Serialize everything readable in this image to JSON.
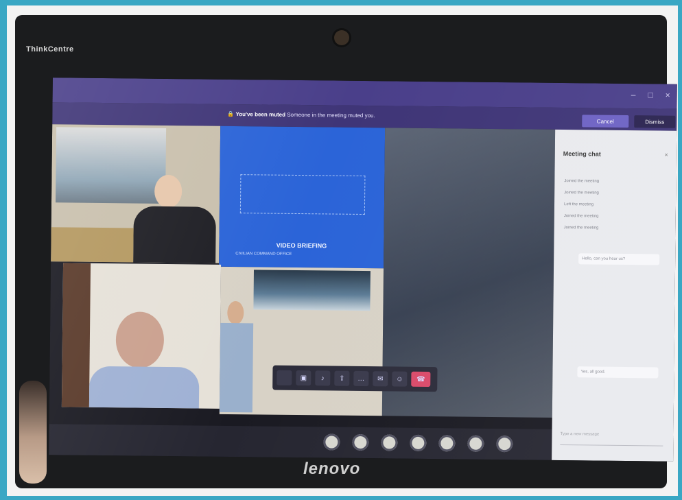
{
  "device": {
    "brand_top": "ThinkCentre",
    "brand_bottom": "lenovo"
  },
  "meeting": {
    "notice_bold": "You've been muted",
    "notice_text": "Someone in the meeting muted you.",
    "cancel_label": "Cancel",
    "dismiss_label": "Dismiss",
    "window_controls": [
      "–",
      "□",
      "×"
    ]
  },
  "presentation": {
    "title": "VIDEO BRIEFING",
    "subtitle": "CIVILIAN COMMAND OFFICE"
  },
  "chat": {
    "title": "Meeting chat",
    "close": "×",
    "lines": [
      "Joined the meeting",
      "Joined the meeting",
      "Left the meeting",
      "Joined the meeting",
      "Joined the meeting"
    ],
    "bubble_1": "Hello, can you hear us?",
    "bubble_2": "Yes, all good.",
    "input_placeholder": "Type a new message"
  },
  "icons": {
    "call_bar": [
      "time",
      "camera-icon",
      "mic-icon",
      "share-icon",
      "more-icon",
      "chat-icon",
      "people-icon",
      "hangup-icon"
    ],
    "taskbar": [
      "app",
      "app",
      "app",
      "app",
      "app",
      "app",
      "app"
    ]
  },
  "colors": {
    "background": "#3aa7c4",
    "teams_purple": "#4a3f8a",
    "slide_blue": "#2b64d8",
    "hangup": "#d94a6a"
  }
}
